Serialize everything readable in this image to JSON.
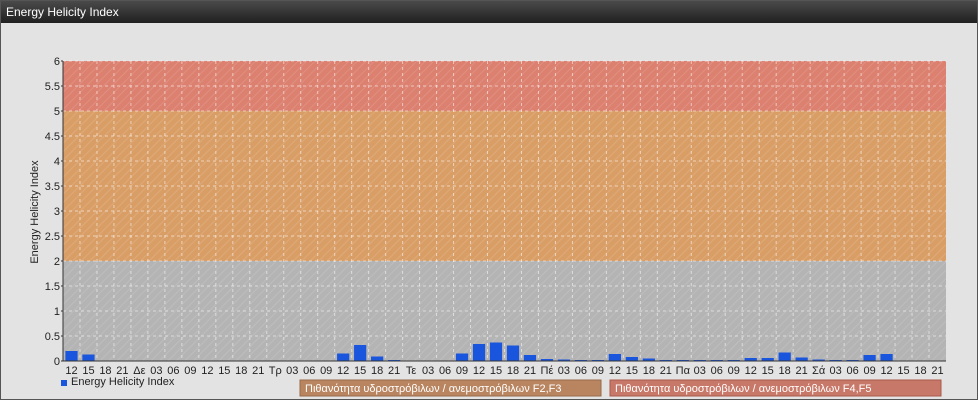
{
  "window": {
    "title": "Energy Helicity Index"
  },
  "chart_data": {
    "type": "bar",
    "title": "",
    "ylabel": "Energy Helicity Index",
    "ylim": [
      0,
      6
    ],
    "yticks": [
      "0",
      "0.5",
      "1",
      "1.5",
      "2",
      "2.5",
      "3",
      "3.5",
      "4",
      "4.5",
      "5",
      "5.5",
      "6"
    ],
    "grid": true,
    "colors": {
      "bar": "#1a55dd",
      "band_low": "#b4b4b4",
      "band_mid": "#d99e66",
      "band_high": "#dc8070",
      "label_mid": "#b88560",
      "label_high": "#c87868"
    },
    "categories": [
      "12",
      "15",
      "18",
      "21",
      "Δε",
      "03",
      "06",
      "09",
      "12",
      "15",
      "18",
      "21",
      "Τρ",
      "03",
      "06",
      "09",
      "12",
      "15",
      "18",
      "21",
      "Τε",
      "03",
      "06",
      "09",
      "12",
      "15",
      "18",
      "21",
      "Πέ",
      "03",
      "06",
      "09",
      "12",
      "15",
      "18",
      "21",
      "Πα",
      "03",
      "06",
      "09",
      "12",
      "15",
      "18",
      "21",
      "Σά",
      "03",
      "06",
      "09",
      "12",
      "15",
      "18",
      "21"
    ],
    "series": [
      {
        "name": "Energy Helicity Index",
        "values": [
          0.2,
          0.13,
          0.01,
          0.01,
          0.01,
          0.01,
          0.01,
          0.01,
          0.01,
          0.01,
          0.01,
          0.01,
          0.01,
          0.01,
          0.01,
          0.01,
          0.15,
          0.32,
          0.09,
          0.02,
          0.01,
          0.01,
          0.01,
          0.15,
          0.34,
          0.37,
          0.31,
          0.12,
          0.04,
          0.03,
          0.02,
          0.02,
          0.14,
          0.08,
          0.05,
          0.02,
          0.02,
          0.02,
          0.02,
          0.02,
          0.06,
          0.06,
          0.17,
          0.07,
          0.03,
          0.02,
          0.02,
          0.12,
          0.14,
          0.01,
          0.01,
          0.01
        ]
      }
    ],
    "bands": [
      {
        "from": 0,
        "to": 2,
        "color_key": "band_low"
      },
      {
        "from": 2,
        "to": 5,
        "color_key": "band_mid"
      },
      {
        "from": 5,
        "to": 6,
        "color_key": "band_high"
      }
    ],
    "legend": {
      "placement": "bottom-left",
      "series_label": "Energy Helicity Index",
      "band_mid_label": "Πιθανότητα υδροστρόβιλων / ανεμοστρόβιλων F2,F3",
      "band_high_label": "Πιθανότητα υδροστρόβιλων / ανεμοστρόβιλων F4,F5"
    }
  }
}
